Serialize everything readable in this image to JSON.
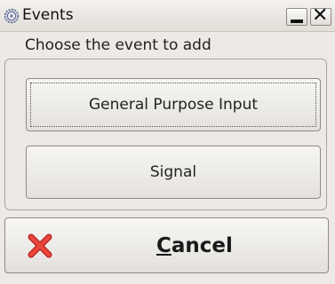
{
  "window": {
    "title": "Events",
    "icon": "gear-icon",
    "minimize_icon": "minimize-icon",
    "close_icon": "close-icon"
  },
  "group": {
    "label": "Choose the event to add"
  },
  "buttons": {
    "general_purpose_input": "General Purpose Input",
    "signal": "Signal"
  },
  "cancel": {
    "mnemonic": "C",
    "rest": "ancel",
    "icon": "red-x-icon"
  },
  "colors": {
    "window_bg": "#ece9e6",
    "cancel_icon": "#e0302a"
  }
}
